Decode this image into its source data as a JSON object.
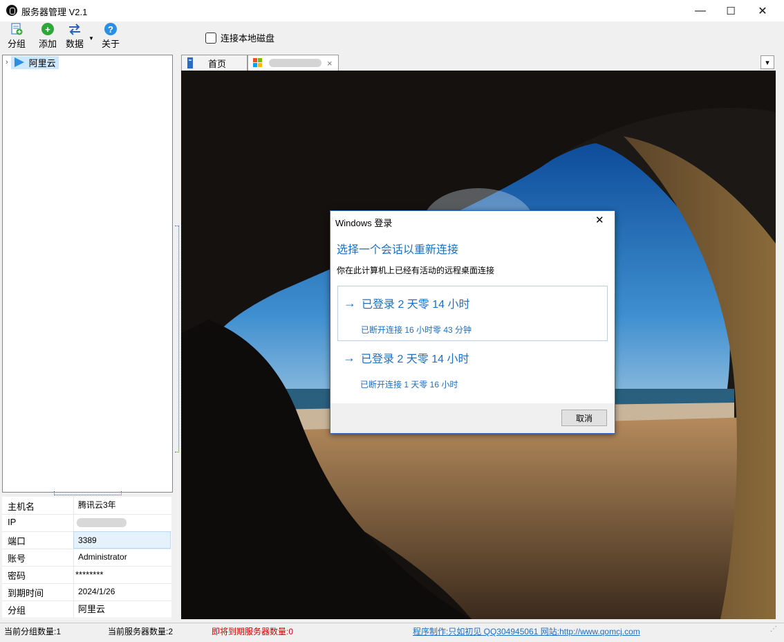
{
  "window": {
    "title": "服务器管理 V2.1",
    "min_glyph": "—",
    "max_glyph": "☐",
    "close_glyph": "✕"
  },
  "toolbar": {
    "group_label": "分组",
    "add_label": "添加",
    "data_label": "数据",
    "about_label": "关于",
    "local_disk_label": "连接本地磁盘",
    "local_disk_checked": false
  },
  "tree": {
    "root_label": "阿里云"
  },
  "props": {
    "rows": [
      {
        "key": "主机名",
        "value": "腾讯云3年"
      },
      {
        "key": "IP",
        "value": ""
      },
      {
        "key": "端口",
        "value": "3389"
      },
      {
        "key": "账号",
        "value": "Administrator"
      },
      {
        "key": "密码",
        "value": "********"
      },
      {
        "key": "到期时间",
        "value": "2024/1/26"
      },
      {
        "key": "分组",
        "value": "阿里云"
      }
    ]
  },
  "tabs": {
    "home_label": "首页",
    "remote_label": "",
    "close_glyph": "×",
    "dropdown_glyph": "▾"
  },
  "dialog": {
    "title": "Windows 登录",
    "close_glyph": "✕",
    "heading": "选择一个会话以重新连接",
    "description": "你在此计算机上已经有活动的远程桌面连接",
    "sessions": [
      {
        "title": "已登录 2 天零 14 小时",
        "subtitle": "已断开连接 16 小时零 43 分钟"
      },
      {
        "title": "已登录 2 天零 14 小时",
        "subtitle": "已断开连接 1 天零 16 小时"
      }
    ],
    "cancel_label": "取消"
  },
  "statusbar": {
    "group_count": "当前分组数量:1",
    "server_count": "当前服务器数量:2",
    "expiring": "即将到期服务器数量:0",
    "credits": "程序制作:只如初见 QQ304945061 网站:http://www.qomcj.com"
  },
  "colors": {
    "accent": "#1e6fc2",
    "expiring": "#cc0000",
    "selection": "#cce8ff"
  }
}
